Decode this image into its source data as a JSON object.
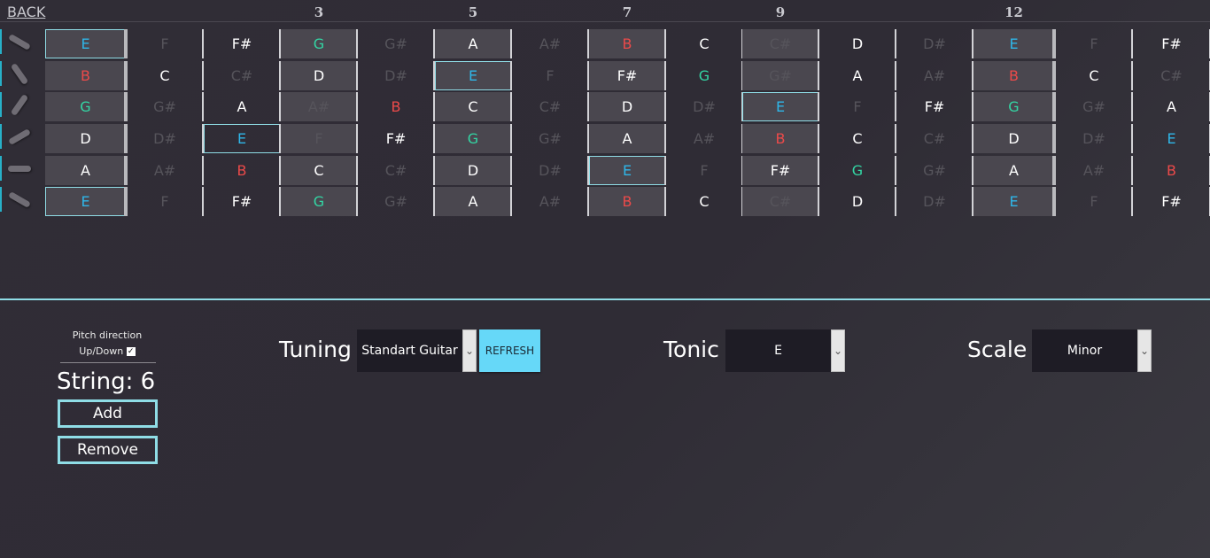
{
  "nav": {
    "back_label": "BACK"
  },
  "fret_markers": [
    "3",
    "5",
    "7",
    "9",
    "12"
  ],
  "colors": {
    "tonic": "#2fb6e8",
    "fifth": "#ec4a4a",
    "third": "#33d6a4",
    "scale": "#ffffff",
    "out_of_scale": "#56545b",
    "selected_border": "#8fdde6",
    "accent": "#66d8f8"
  },
  "strings": [
    {
      "label": "string-1",
      "tilt": "down",
      "notes": [
        "E",
        "F",
        "F#",
        "G",
        "G#",
        "A",
        "A#",
        "B",
        "C",
        "C#",
        "D",
        "D#",
        "E",
        "F",
        "F#"
      ]
    },
    {
      "label": "string-2",
      "tilt": "steep",
      "notes": [
        "B",
        "C",
        "C#",
        "D",
        "D#",
        "E",
        "F",
        "F#",
        "G",
        "G#",
        "A",
        "A#",
        "B",
        "C",
        "C#"
      ]
    },
    {
      "label": "string-3",
      "tilt": "up-steep",
      "notes": [
        "G",
        "G#",
        "A",
        "A#",
        "B",
        "C",
        "C#",
        "D",
        "D#",
        "E",
        "F",
        "F#",
        "G",
        "G#",
        "A"
      ]
    },
    {
      "label": "string-4",
      "tilt": "up",
      "notes": [
        "D",
        "D#",
        "E",
        "F",
        "F#",
        "G",
        "G#",
        "A",
        "A#",
        "B",
        "C",
        "C#",
        "D",
        "D#",
        "E"
      ]
    },
    {
      "label": "string-5",
      "tilt": "flat",
      "notes": [
        "A",
        "A#",
        "B",
        "C",
        "C#",
        "D",
        "D#",
        "E",
        "F",
        "F#",
        "G",
        "G#",
        "A",
        "A#",
        "B"
      ]
    },
    {
      "label": "string-6",
      "tilt": "down",
      "notes": [
        "E",
        "F",
        "F#",
        "G",
        "G#",
        "A",
        "A#",
        "B",
        "C",
        "C#",
        "D",
        "D#",
        "E",
        "F",
        "F#"
      ]
    }
  ],
  "controls": {
    "pitch_direction_label": "Pitch direction",
    "updown_label": "Up/Down",
    "updown_checked": true,
    "string_label": "String: 6",
    "add_label": "Add",
    "remove_label": "Remove",
    "tuning_label": "Tuning",
    "tuning_value": "Standart Guitar",
    "refresh_label": "REFRESH",
    "tonic_label": "Tonic",
    "tonic_value": "E",
    "scale_label": "Scale",
    "scale_value": "Minor",
    "dropdown_icon": "chevron-down-icon"
  }
}
